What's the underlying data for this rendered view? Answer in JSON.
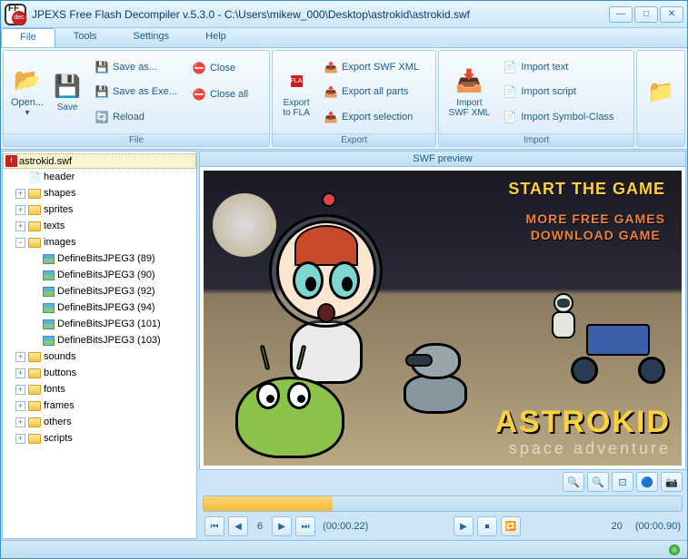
{
  "title": "JPEXS Free Flash Decompiler v.5.3.0 - C:\\Users\\mikew_000\\Desktop\\astrokid\\astrokid.swf",
  "menubar": {
    "file": "File",
    "tools": "Tools",
    "settings": "Settings",
    "help": "Help"
  },
  "ribbon": {
    "file": {
      "label": "File",
      "open": "Open...",
      "save": "Save",
      "save_as": "Save as...",
      "save_as_exe": "Save as Exe...",
      "reload": "Reload",
      "close": "Close",
      "close_all": "Close all"
    },
    "export": {
      "label": "Export",
      "to_fla": "Export to FLA",
      "swf_xml": "Export SWF XML",
      "all_parts": "Export all parts",
      "selection": "Export selection"
    },
    "import": {
      "label": "Import",
      "swf_xml": "Import SWF XML",
      "text": "Import text",
      "script": "Import script",
      "symbol": "Import Symbol-Class"
    }
  },
  "tree": {
    "root": "astrokid.swf",
    "header": "header",
    "shapes": "shapes",
    "sprites": "sprites",
    "texts": "texts",
    "images": "images",
    "image_items": [
      "DefineBitsJPEG3 (89)",
      "DefineBitsJPEG3 (90)",
      "DefineBitsJPEG3 (92)",
      "DefineBitsJPEG3 (94)",
      "DefineBitsJPEG3 (101)",
      "DefineBitsJPEG3 (103)"
    ],
    "sounds": "sounds",
    "buttons": "buttons",
    "fonts": "fonts",
    "frames": "frames",
    "others": "others",
    "scripts": "scripts"
  },
  "preview": {
    "tab": "SWF preview",
    "game_menu1": "START THE GAME",
    "game_menu2": "MORE FREE GAMES\nDOWNLOAD GAME",
    "game_title": "ASTROKID",
    "game_sub": "space adventure"
  },
  "playback": {
    "frame_current": "6",
    "time_current": "(00:00.22)",
    "frame_total": "20",
    "time_total": "(00:00.90)"
  }
}
